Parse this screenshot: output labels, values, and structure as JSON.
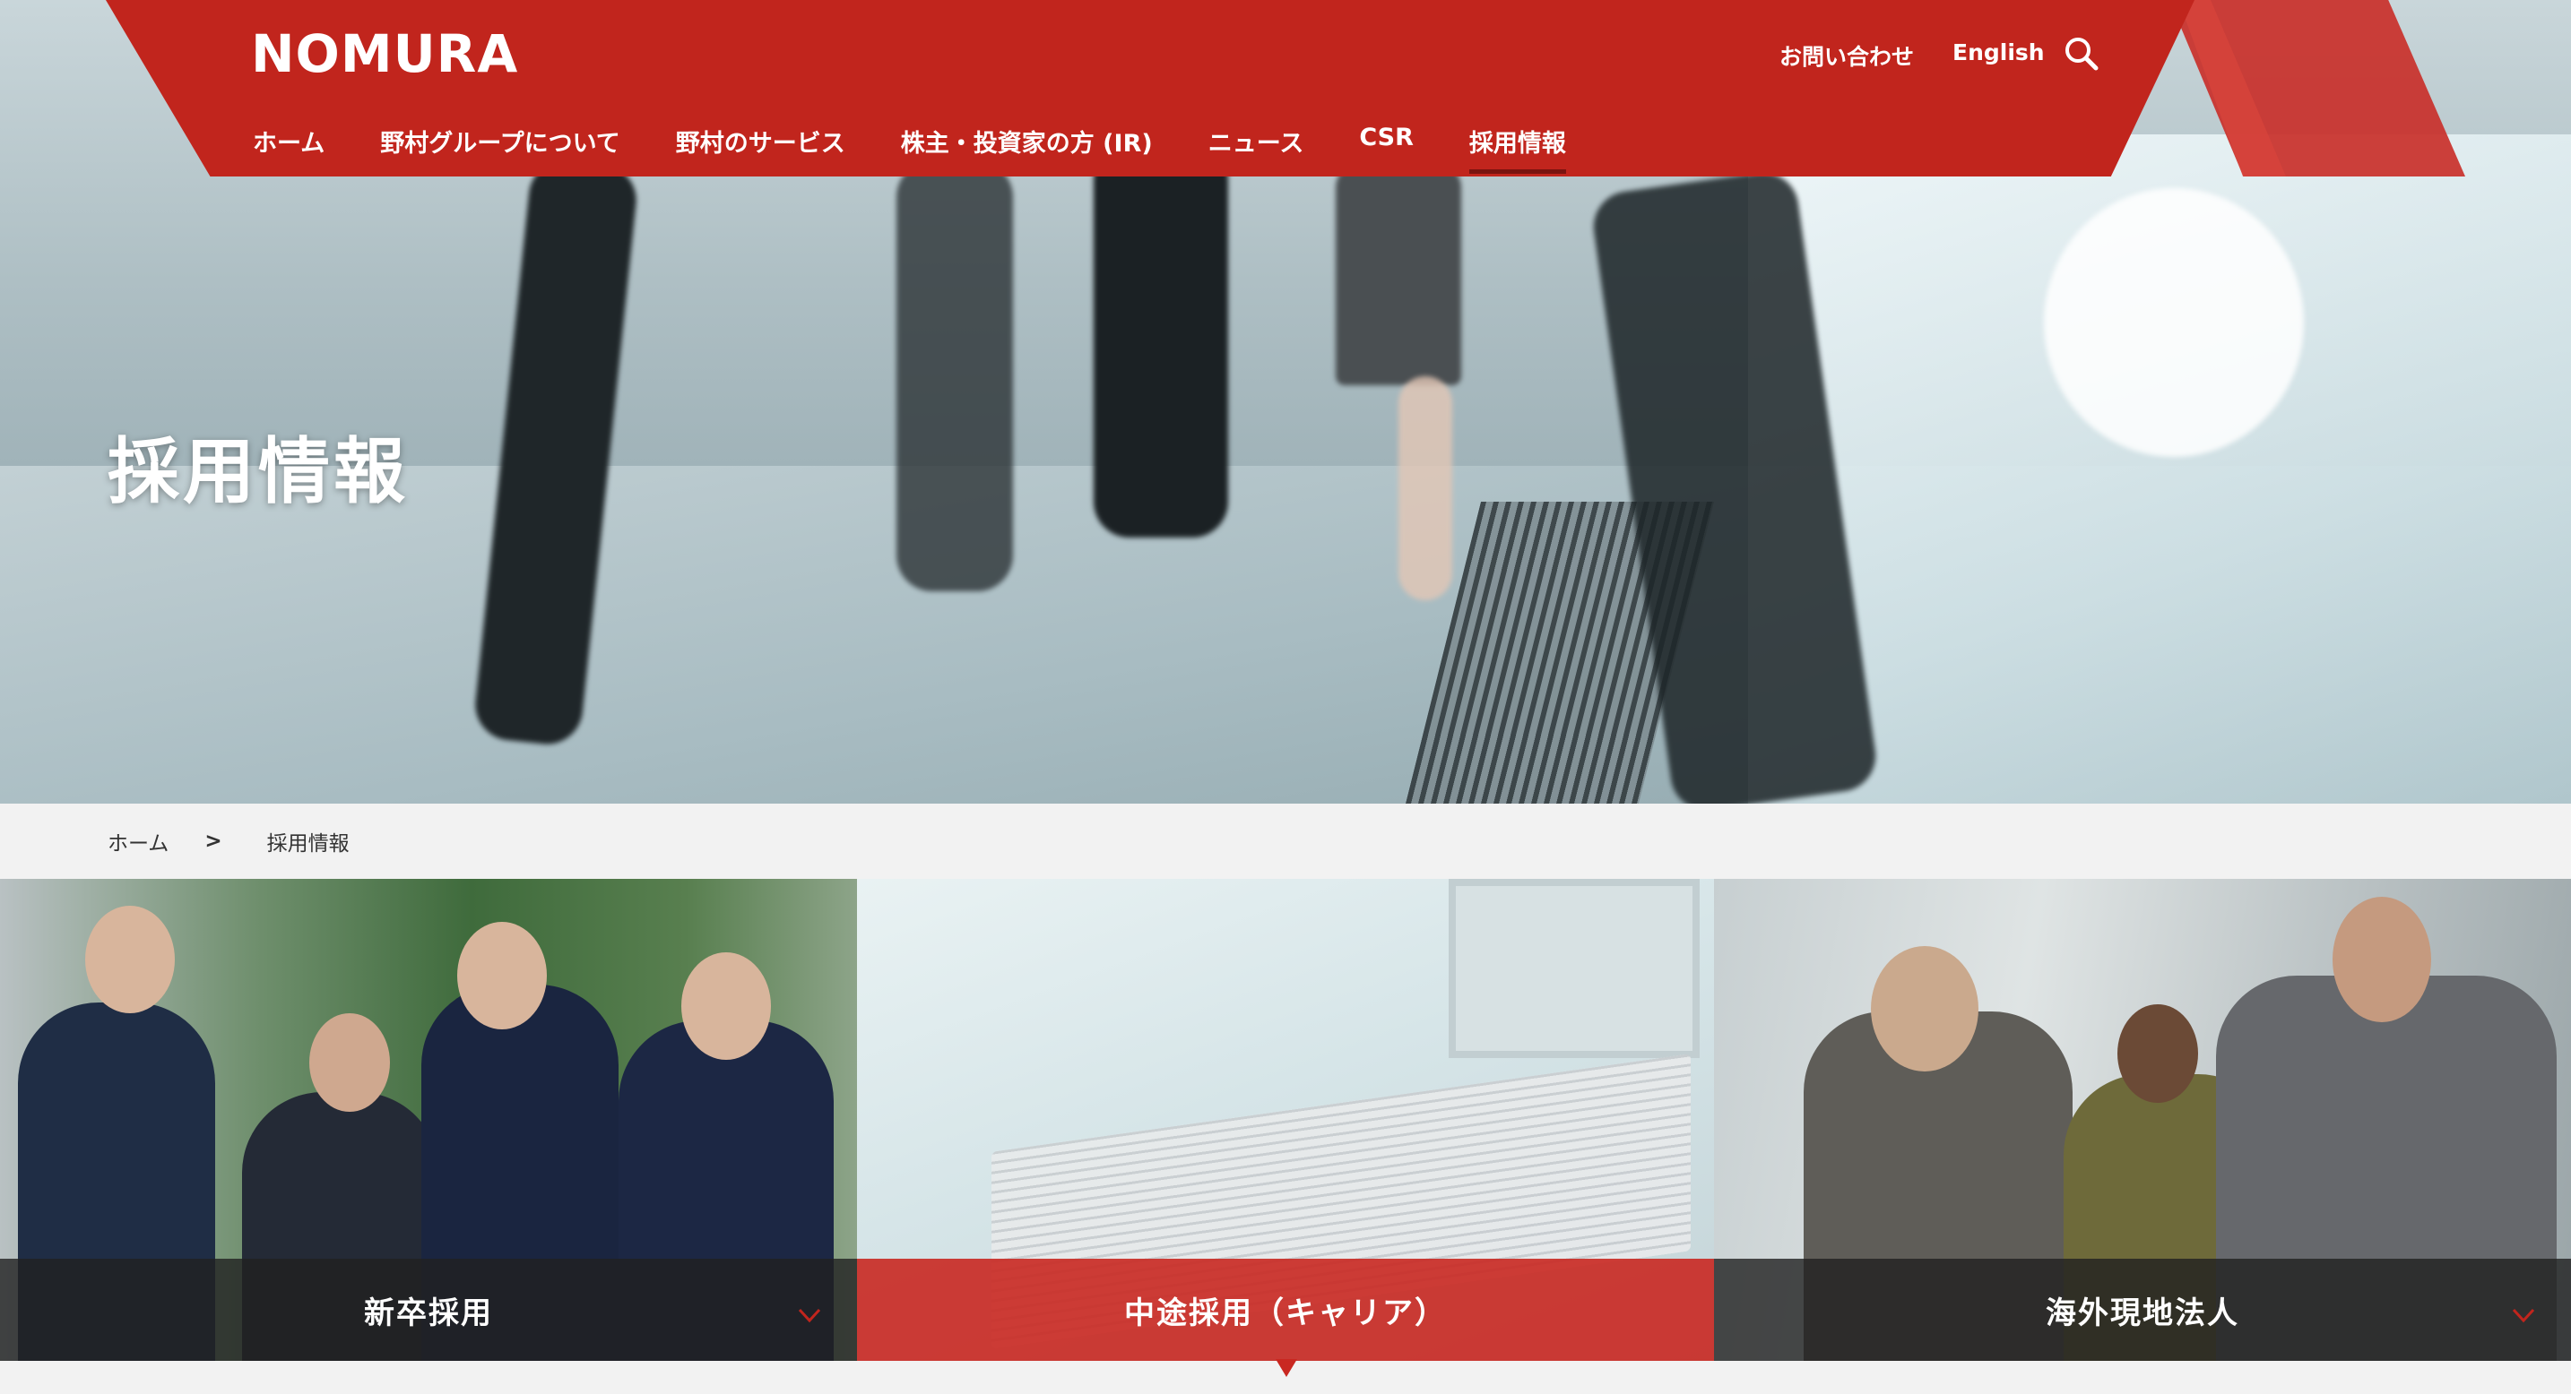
{
  "header": {
    "logo": "NOMURA",
    "contact_label": "お問い合わせ",
    "english_label": "English",
    "search_icon": "search-icon",
    "brand_color": "#c1251d"
  },
  "nav": {
    "items": [
      {
        "label": "ホーム"
      },
      {
        "label": "野村グループについて"
      },
      {
        "label": "野村のサービス"
      },
      {
        "label": "株主・投資家の方 (IR)"
      },
      {
        "label": "ニュース"
      },
      {
        "label": "CSR"
      },
      {
        "label": "採用情報",
        "active": true
      }
    ]
  },
  "hero": {
    "title": "採用情報"
  },
  "breadcrumb": {
    "home": "ホーム",
    "separator": ">",
    "current": "採用情報"
  },
  "tiles": [
    {
      "label": "新卒採用",
      "icon": "chevron-down-icon"
    },
    {
      "label": "中途採用（キャリア）",
      "highlighted": true
    },
    {
      "label": "海外現地法人",
      "icon": "chevron-down-icon"
    }
  ]
}
